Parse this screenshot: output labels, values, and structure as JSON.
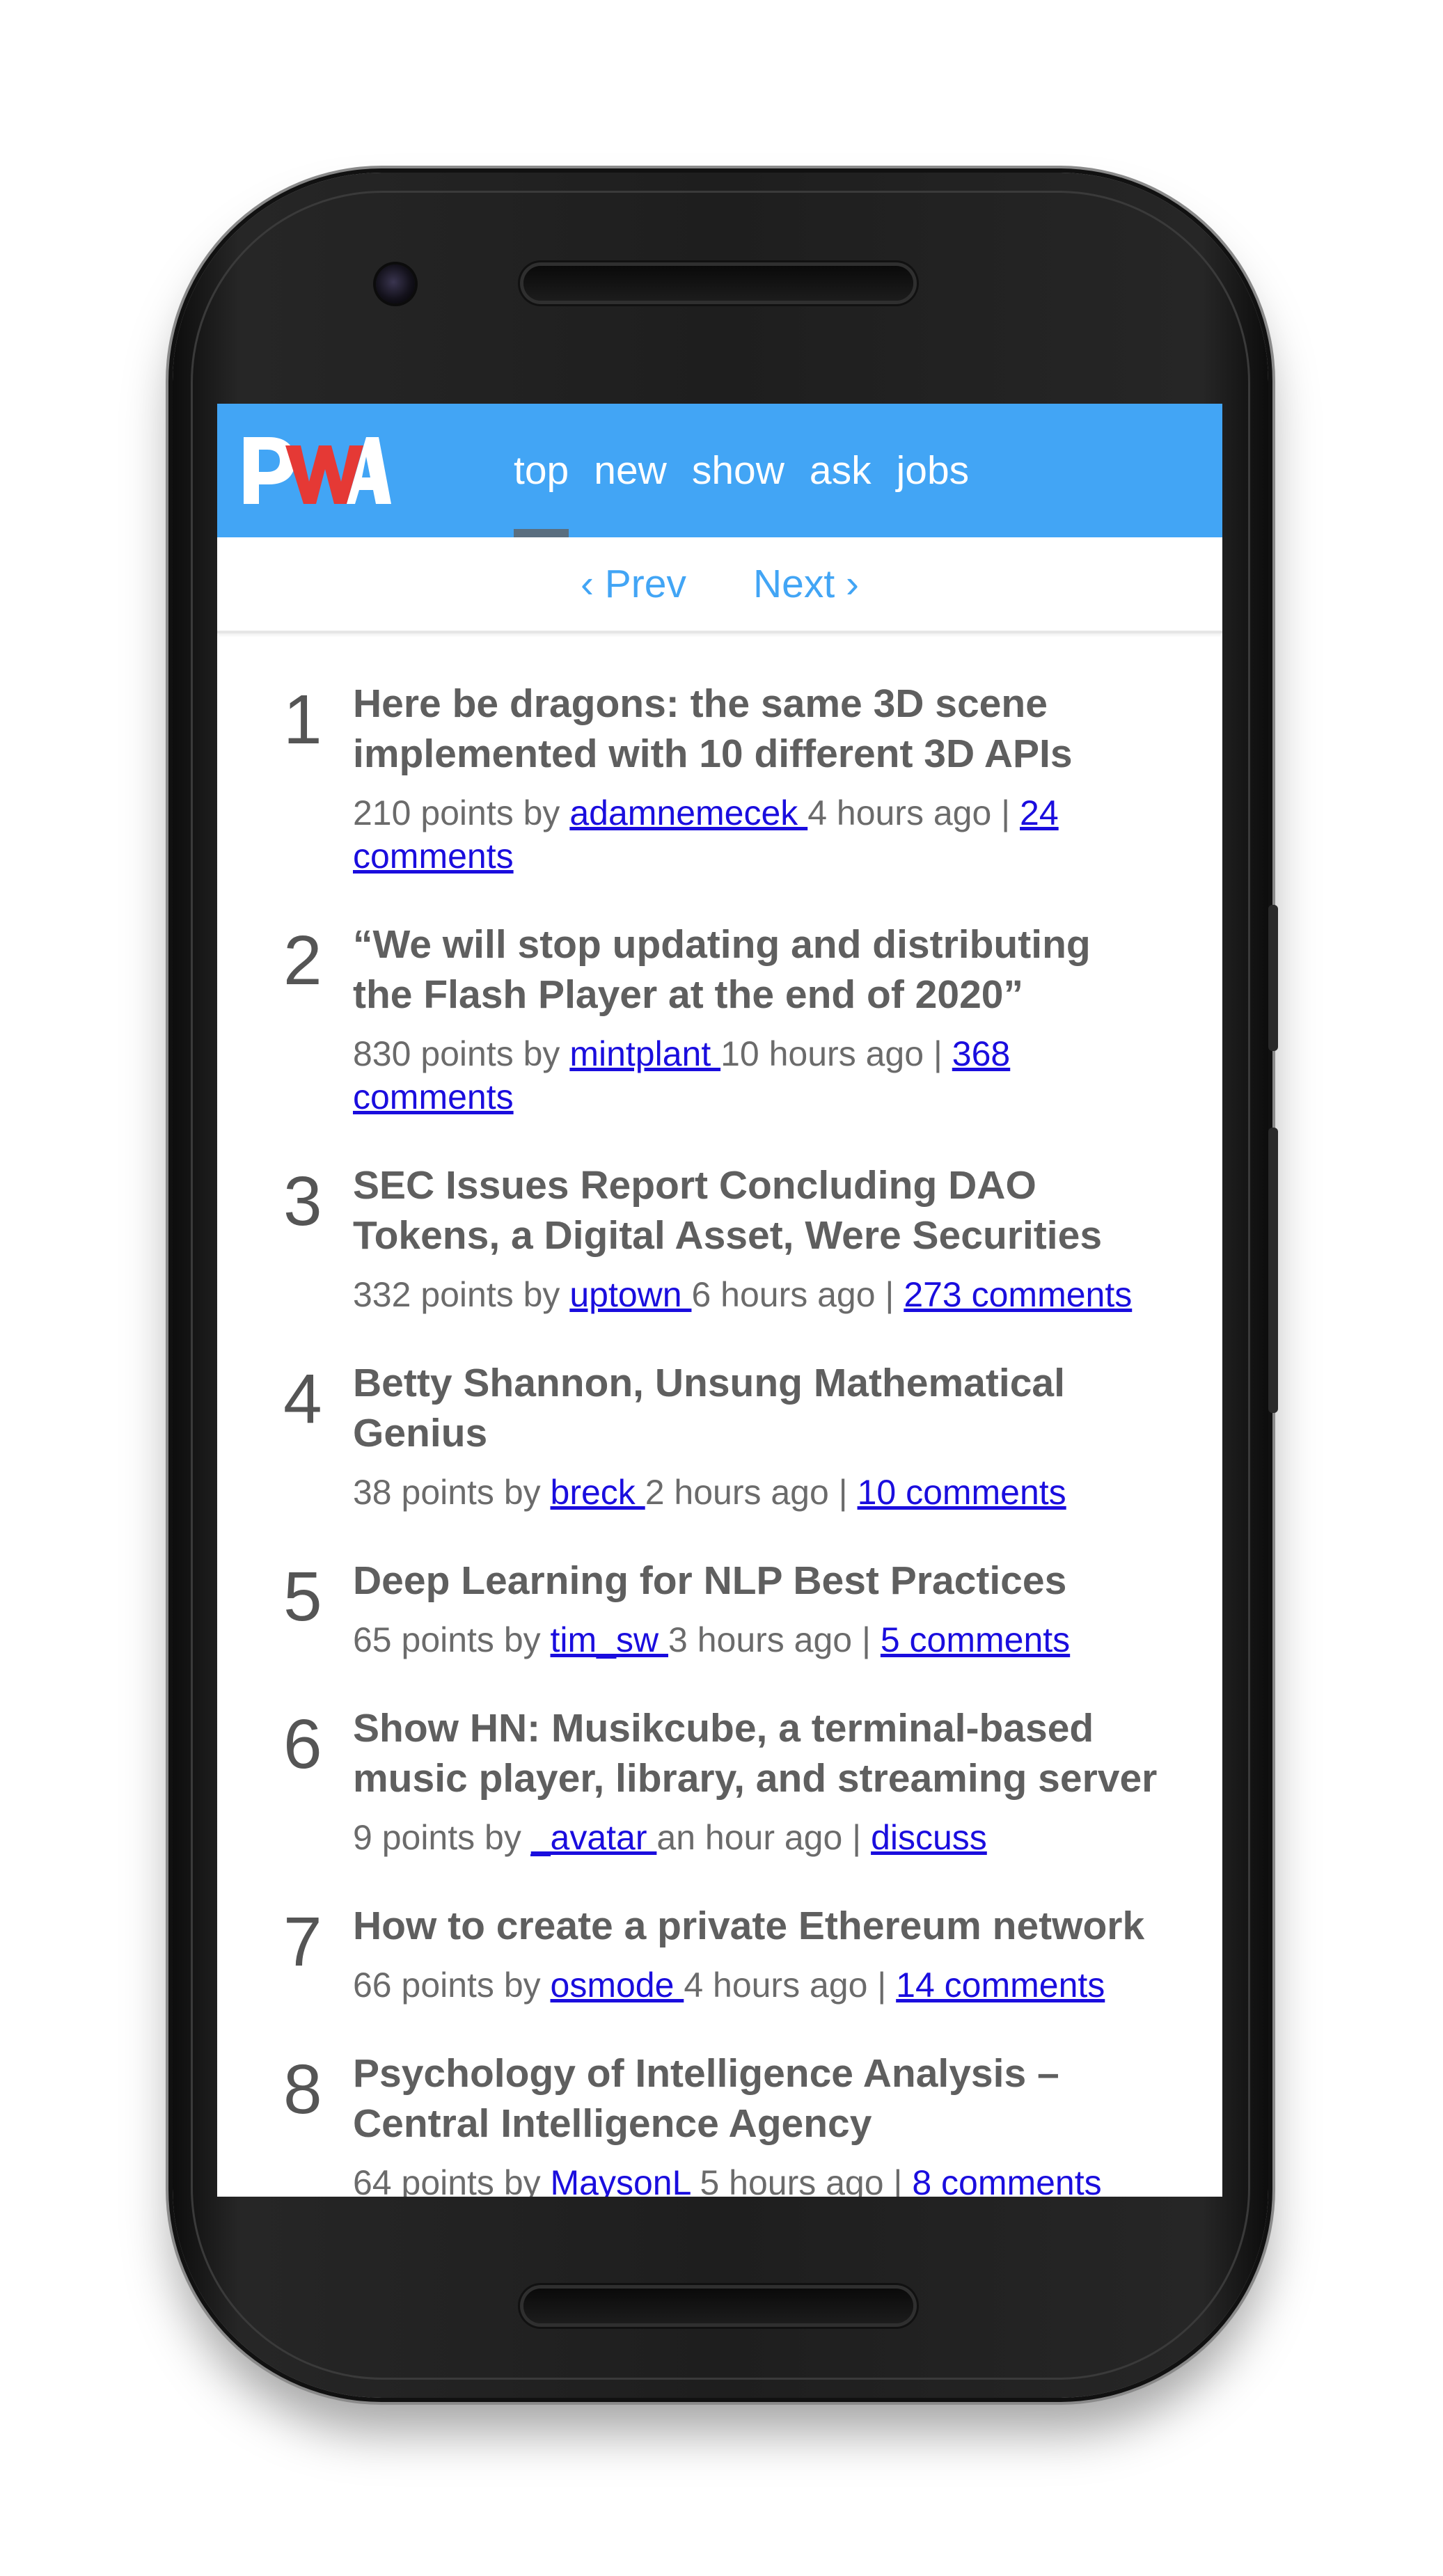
{
  "brand": {
    "logo_text": "PWA",
    "header_color": "#42a5f5",
    "accent_color": "#e53935"
  },
  "nav": {
    "items": [
      "top",
      "new",
      "show",
      "ask",
      "jobs"
    ],
    "active": "top"
  },
  "pager": {
    "prev_label": "‹ Prev",
    "next_label": "Next ›"
  },
  "stories": [
    {
      "rank": "1",
      "title": "Here be dragons: the same 3D scene implemented with 10 different 3D APIs",
      "points_by": "210 points by ",
      "user": "adamnemecek ",
      "time": "4 hours ago | ",
      "comments": "24 comments"
    },
    {
      "rank": "2",
      "title": "“We will stop updating and distributing the Flash Player at the end of 2020”",
      "points_by": "830 points by ",
      "user": "mintplant ",
      "time": "10 hours ago | ",
      "comments": "368 comments"
    },
    {
      "rank": "3",
      "title": "SEC Issues Report Concluding DAO Tokens, a Digital Asset, Were Securities",
      "points_by": "332 points by ",
      "user": "uptown ",
      "time": "6 hours ago | ",
      "comments": "273 comments"
    },
    {
      "rank": "4",
      "title": "Betty Shannon, Unsung Mathematical Genius",
      "points_by": "38 points by ",
      "user": "breck ",
      "time": "2 hours ago | ",
      "comments": "10 comments"
    },
    {
      "rank": "5",
      "title": "Deep Learning for NLP Best Practices",
      "points_by": "65 points by ",
      "user": "tim_sw ",
      "time": "3 hours ago | ",
      "comments": "5 comments"
    },
    {
      "rank": "6",
      "title": "Show HN: Musikcube, a terminal-based music player, library, and streaming server",
      "points_by": "9 points by ",
      "user": "_avatar ",
      "time": "an hour ago | ",
      "comments": "discuss"
    },
    {
      "rank": "7",
      "title": "How to create a private Ethereum network",
      "points_by": "66 points by ",
      "user": "osmode ",
      "time": "4 hours ago | ",
      "comments": "14 comments"
    },
    {
      "rank": "8",
      "title": "Psychology of Intelligence Analysis – Central Intelligence Agency",
      "points_by": "64 points by ",
      "user": "MaysonL ",
      "time": "5 hours ago | ",
      "comments": "8 comments"
    }
  ]
}
